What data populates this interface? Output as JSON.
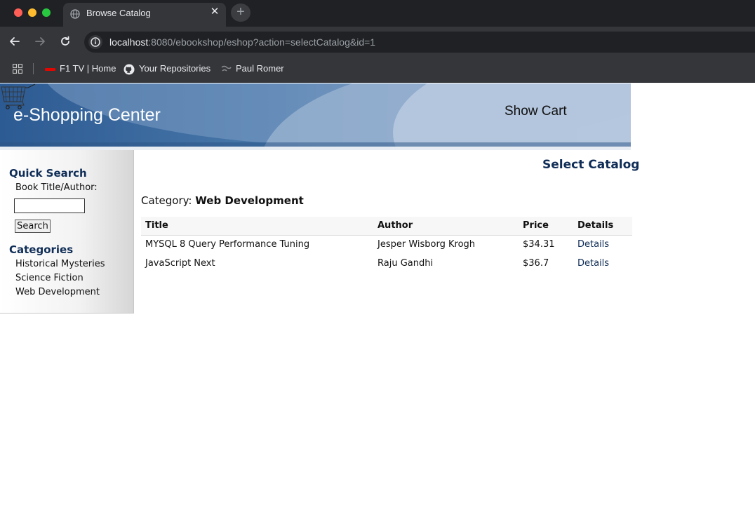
{
  "browser": {
    "tab_title": "Browse Catalog",
    "url_host": "localhost",
    "url_rest": ":8080/ebookshop/eshop?action=selectCatalog&id=1",
    "bookmarks": [
      {
        "label": "F1 TV | Home",
        "icon": "f1-icon"
      },
      {
        "label": "Your Repositories",
        "icon": "github-icon"
      },
      {
        "label": "Paul Romer",
        "icon": "site-icon"
      }
    ]
  },
  "banner": {
    "title": "e-Shopping Center",
    "show_cart": "Show Cart"
  },
  "sidebar": {
    "quick_search_heading": "Quick Search",
    "field_label": "Book Title/Author:",
    "field_value": "",
    "search_button": "Search",
    "categories_heading": "Categories",
    "categories": [
      "Historical Mysteries",
      "Science Fiction",
      "Web Development"
    ]
  },
  "main": {
    "heading": "Select Catalog",
    "category_prefix": "Category:",
    "category_name": "Web Development",
    "columns": [
      "Title",
      "Author",
      "Price",
      "Details"
    ],
    "rows": [
      {
        "title": "MYSQL 8 Query Performance Tuning",
        "author": "Jesper Wisborg Krogh",
        "price": "$34.31",
        "details": "Details"
      },
      {
        "title": "JavaScript Next",
        "author": "Raju Gandhi",
        "price": "$36.7",
        "details": "Details"
      }
    ]
  },
  "colors": {
    "heading_navy": "#0f2d57",
    "banner_blue": "#2f5f95",
    "chrome_dark": "#202124"
  }
}
